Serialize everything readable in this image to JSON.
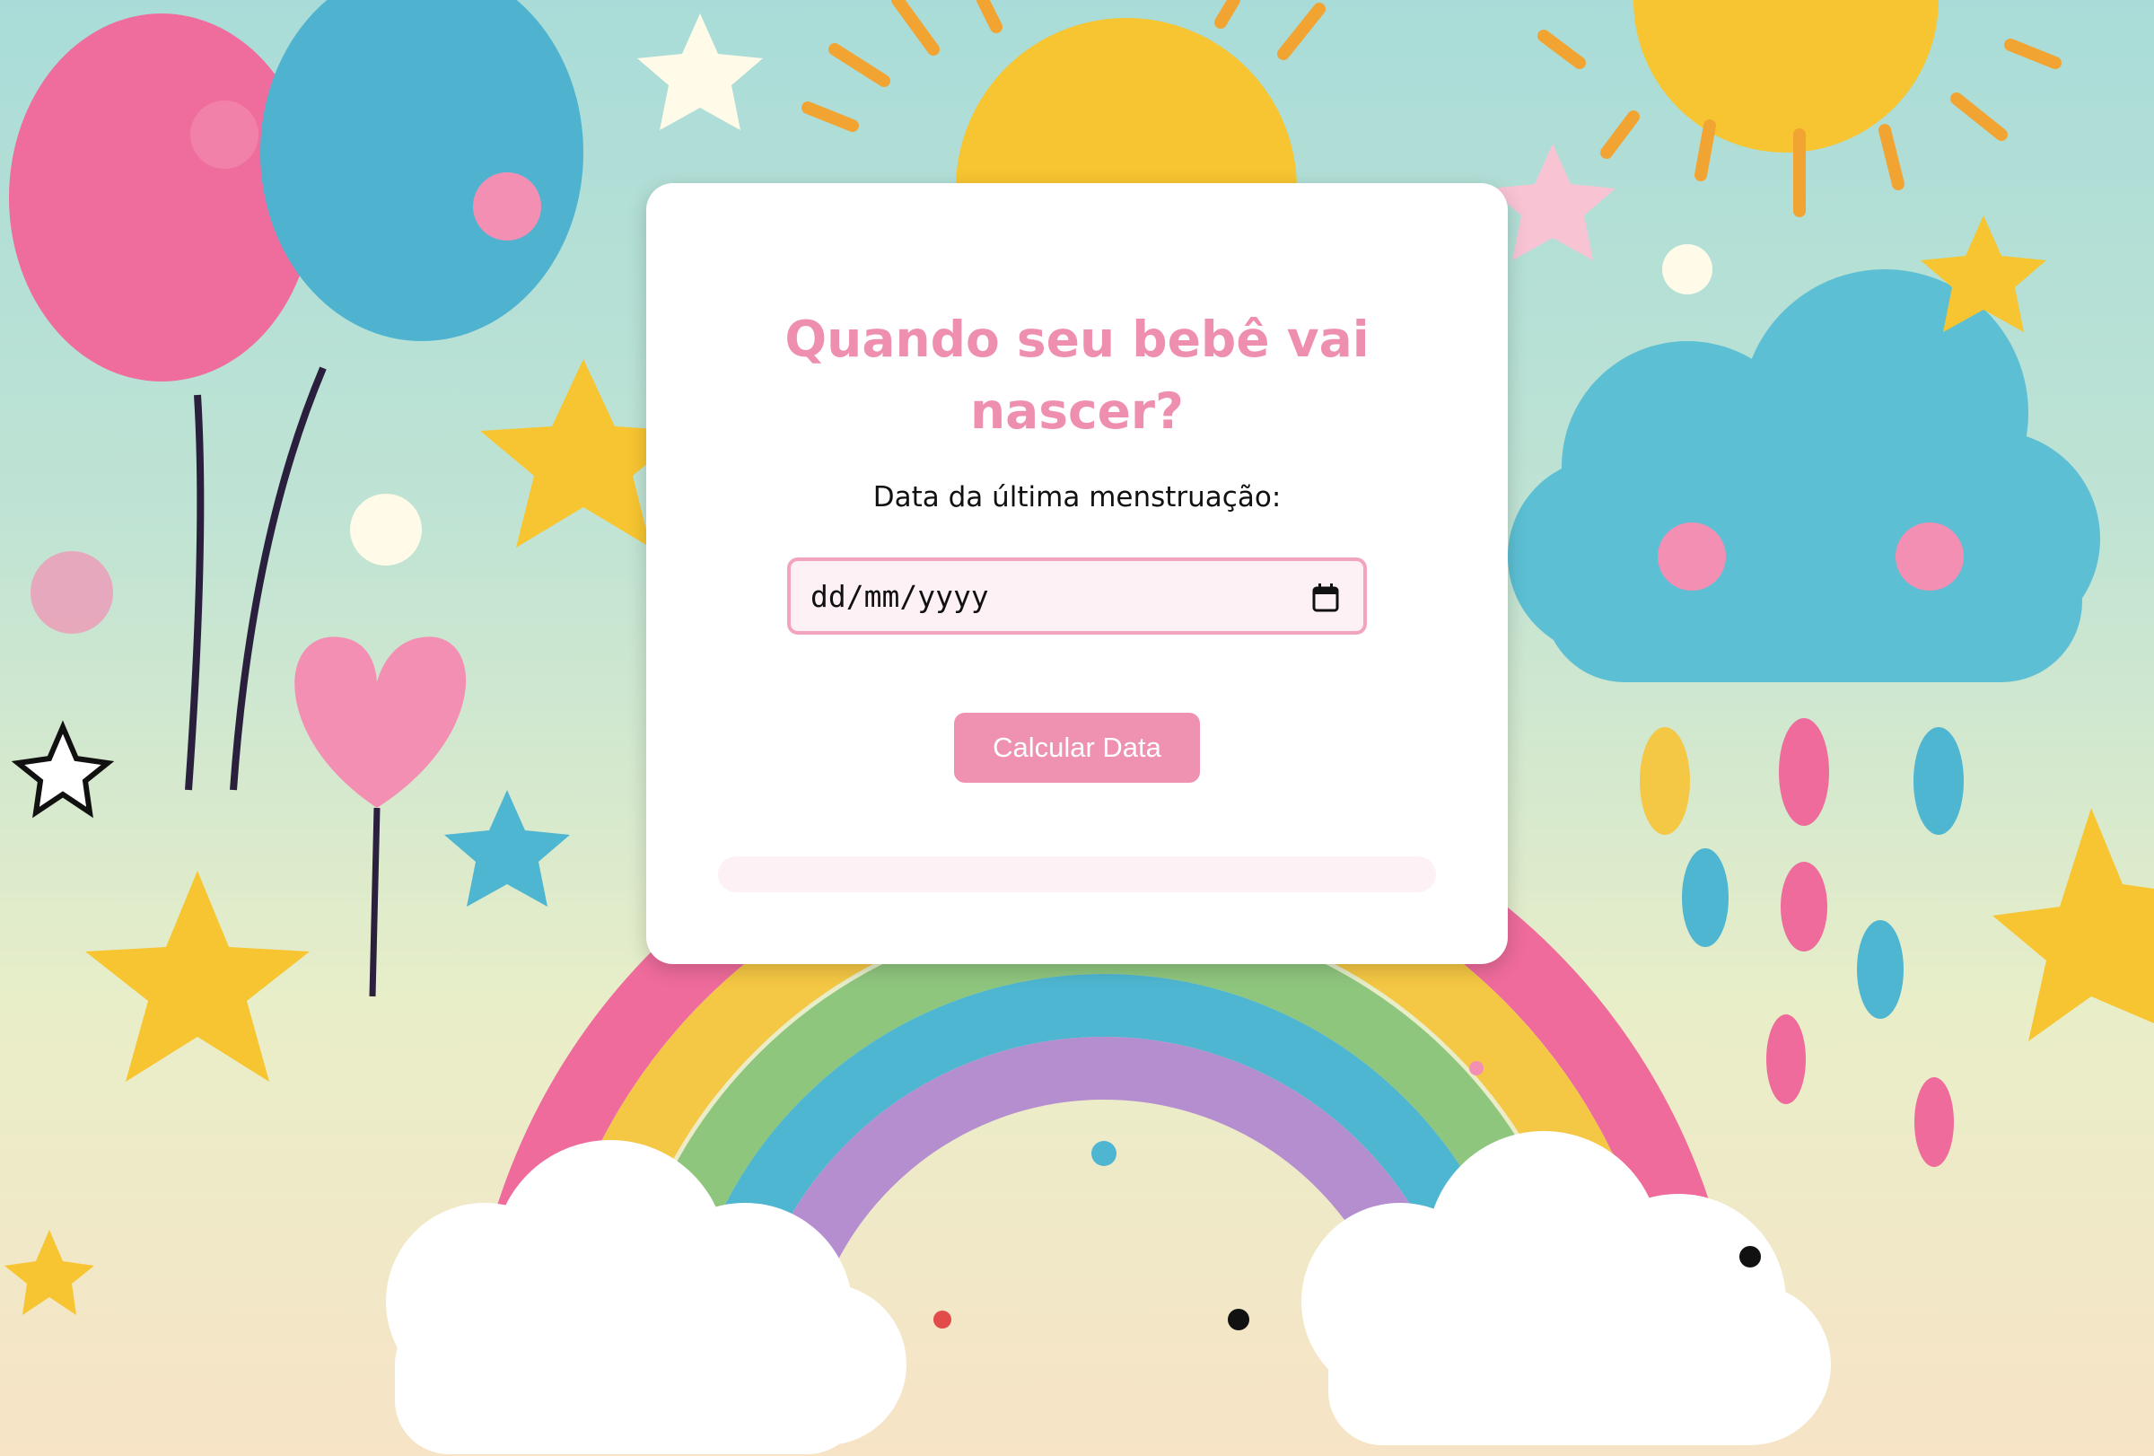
{
  "form": {
    "title": "Quando seu bebê vai nascer?",
    "date_label": "Data da última menstruação:",
    "date_placeholder": "dd/mm/yyyy",
    "calc_button": "Calcular Data",
    "result_text": ""
  },
  "colors": {
    "accent": "#ef91b1",
    "title": "#ef8fb0",
    "input_border": "#f2a3bd",
    "input_bg": "#fdf1f5"
  },
  "icons": {
    "date_picker": "calendar-icon"
  }
}
